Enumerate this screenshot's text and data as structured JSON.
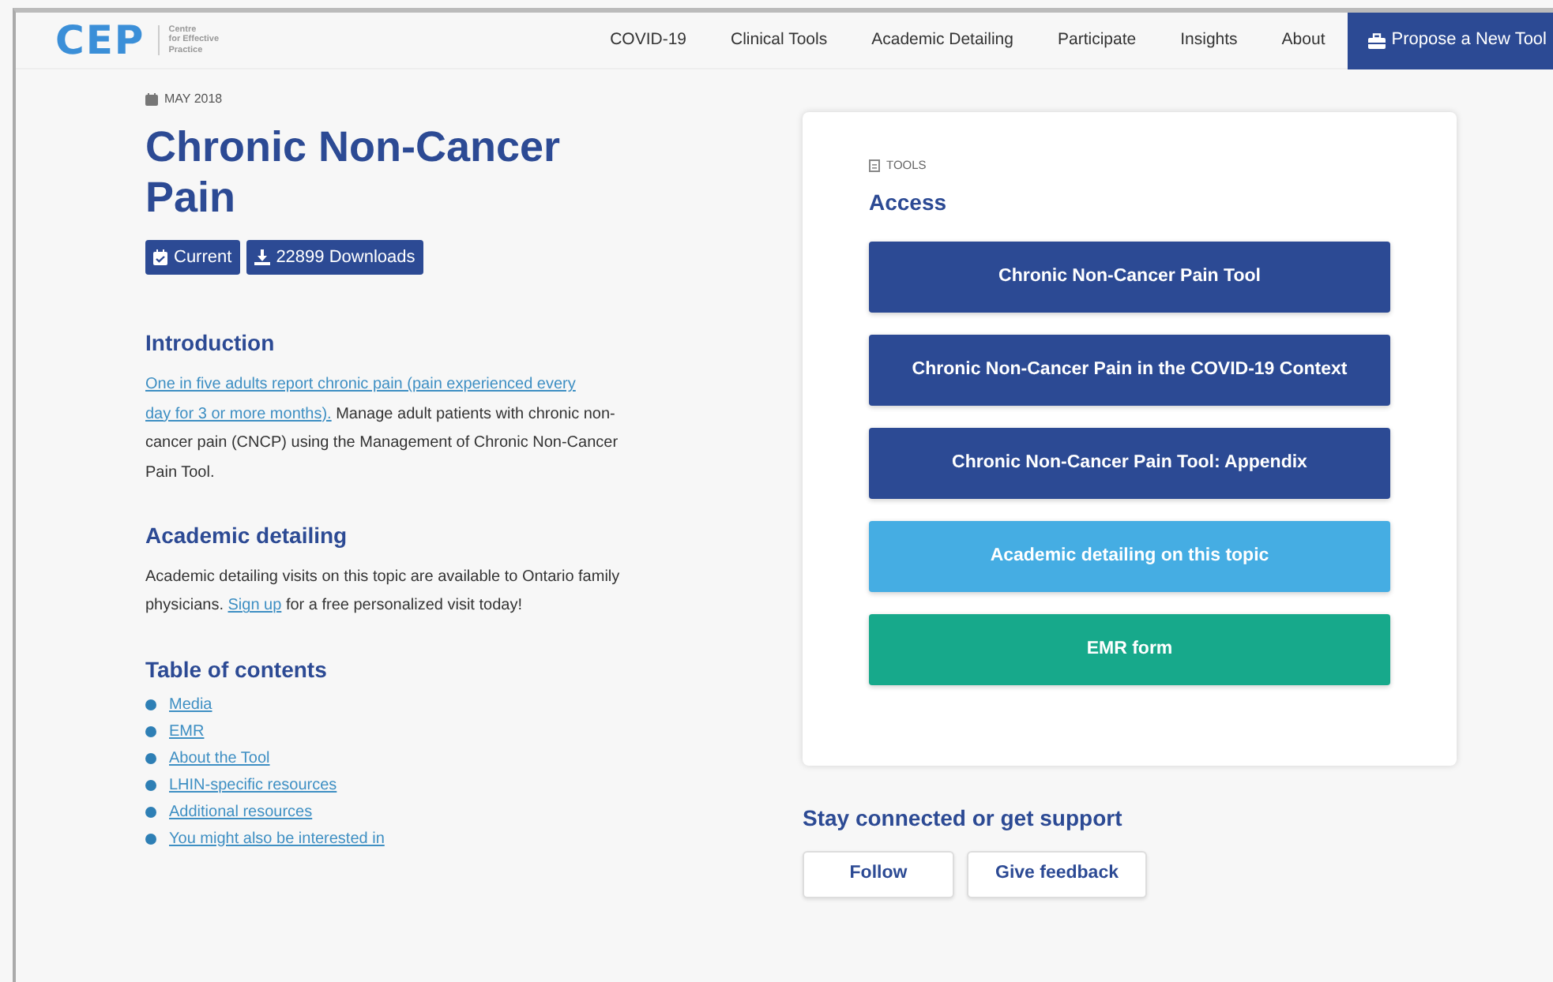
{
  "header": {
    "logo": "CEP",
    "logo_tagline": [
      "Centre",
      "for Effective",
      "Practice"
    ],
    "nav": [
      {
        "label": "COVID-19"
      },
      {
        "label": "Clinical Tools"
      },
      {
        "label": "Academic Detailing"
      },
      {
        "label": "Participate"
      },
      {
        "label": "Insights"
      },
      {
        "label": "About"
      }
    ],
    "cta": "Propose a New Tool"
  },
  "date": "MAY 2018",
  "title": "Chronic Non-Cancer Pain",
  "badges": [
    {
      "kind": "status",
      "label": "Current"
    },
    {
      "kind": "downloads",
      "label": "22899 Downloads"
    }
  ],
  "introduction": {
    "heading": "Introduction",
    "link_lines": [
      "One in five adults report chronic pain (pain experienced every",
      "day for 3 or more months)."
    ],
    "text": " Manage adult patients with chronic non-cancer pain (CNCP) using the Management of Chronic Non-Cancer Pain Tool."
  },
  "academic_detailing": {
    "heading": "Academic detailing",
    "text_before": "Academic detailing visits on this topic are available to Ontario family physicians. ",
    "link": "Sign up",
    "text_after": " for a free personalized visit today!"
  },
  "toc": {
    "heading": "Table of contents",
    "items": [
      "Media",
      "EMR",
      "About the Tool",
      "LHIN-specific resources",
      "Additional resources",
      "You might also be interested in"
    ]
  },
  "tools_card": {
    "label": "TOOLS",
    "heading": "Access",
    "buttons": [
      {
        "label": "Chronic Non-Cancer Pain Tool",
        "color": "#2c4a94"
      },
      {
        "label": "Chronic Non-Cancer Pain in the COVID-19 Context",
        "color": "#2c4a94"
      },
      {
        "label": "Chronic Non-Cancer Pain Tool: Appendix",
        "color": "#2c4a94"
      },
      {
        "label": "Academic detailing on this topic",
        "color": "#45ade3"
      },
      {
        "label": "EMR form",
        "color": "#17a98b"
      }
    ]
  },
  "support": {
    "heading": "Stay connected or get support",
    "buttons": [
      "Follow",
      "Give feedback"
    ]
  }
}
